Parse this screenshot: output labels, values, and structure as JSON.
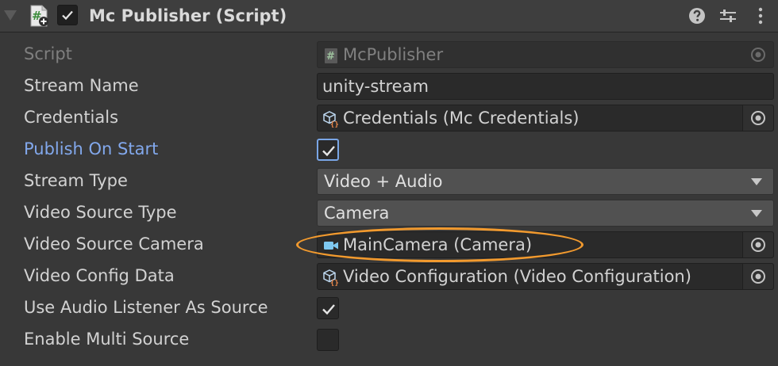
{
  "component": {
    "title": "Mc Publisher (Script)",
    "enabled": true
  },
  "fields": {
    "script": {
      "label": "Script",
      "value": "McPublisher"
    },
    "stream_name": {
      "label": "Stream Name",
      "value": "unity-stream"
    },
    "credentials": {
      "label": "Credentials",
      "value": "Credentials (Mc Credentials)"
    },
    "publish_on_start": {
      "label": "Publish On Start",
      "checked": true
    },
    "stream_type": {
      "label": "Stream Type",
      "value": "Video + Audio"
    },
    "video_source_type": {
      "label": "Video Source Type",
      "value": "Camera"
    },
    "video_source_camera": {
      "label": "Video Source Camera",
      "value": "MainCamera (Camera)"
    },
    "video_config_data": {
      "label": "Video Config Data",
      "value": "Video Configuration (Video Configuration)"
    },
    "use_audio_listener": {
      "label": "Use Audio Listener As Source",
      "checked": true
    },
    "enable_multi_source": {
      "label": "Enable Multi Source",
      "checked": false
    }
  },
  "icons": {
    "foldout": "triangle-down-icon",
    "script": "cs-script-icon",
    "help": "help-icon",
    "presets": "presets-sliders-icon",
    "more": "kebab-menu-icon",
    "object_picker": "object-picker-icon",
    "scriptable_object": "scriptable-object-icon",
    "camera": "camera-icon"
  },
  "colors": {
    "background": "#383838",
    "header": "#3e3e3e",
    "field": "#2a2a2a",
    "label": "#d2d2d2",
    "modified_label": "#82a8ec",
    "highlight_ring": "#f29a2e",
    "camera_icon": "#7ec8f0"
  }
}
